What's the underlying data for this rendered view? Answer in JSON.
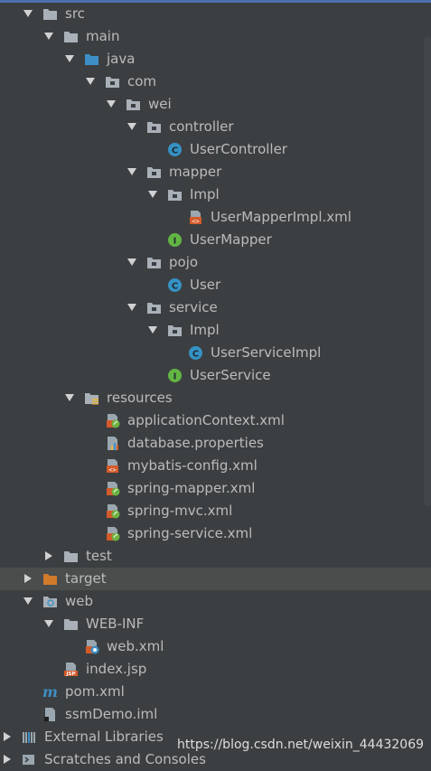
{
  "tree": [
    {
      "label": "src",
      "level": 0,
      "expanded": true,
      "icon": "folder-icon"
    },
    {
      "label": "main",
      "level": 1,
      "expanded": true,
      "icon": "folder-icon"
    },
    {
      "label": "java",
      "level": 2,
      "expanded": true,
      "icon": "source-folder-icon"
    },
    {
      "label": "com",
      "level": 3,
      "expanded": true,
      "icon": "package-icon"
    },
    {
      "label": "wei",
      "level": 4,
      "expanded": true,
      "icon": "package-icon"
    },
    {
      "label": "controller",
      "level": 5,
      "expanded": true,
      "icon": "package-icon"
    },
    {
      "label": "UserController",
      "level": 6,
      "icon": "class-icon"
    },
    {
      "label": "mapper",
      "level": 5,
      "expanded": true,
      "icon": "package-icon"
    },
    {
      "label": "Impl",
      "level": 6,
      "expanded": true,
      "icon": "package-icon"
    },
    {
      "label": "UserMapperImpl.xml",
      "level": 7,
      "icon": "xml-file-icon"
    },
    {
      "label": "UserMapper",
      "level": 6,
      "icon": "interface-icon"
    },
    {
      "label": "pojo",
      "level": 5,
      "expanded": true,
      "icon": "package-icon"
    },
    {
      "label": "User",
      "level": 6,
      "icon": "class-icon"
    },
    {
      "label": "service",
      "level": 5,
      "expanded": true,
      "icon": "package-icon"
    },
    {
      "label": "Impl",
      "level": 6,
      "expanded": true,
      "icon": "package-icon"
    },
    {
      "label": "UserServiceImpl",
      "level": 7,
      "icon": "class-icon"
    },
    {
      "label": "UserService",
      "level": 6,
      "icon": "interface-icon"
    },
    {
      "label": "resources",
      "level": 2,
      "expanded": true,
      "icon": "resources-folder-icon"
    },
    {
      "label": "applicationContext.xml",
      "level": 3,
      "icon": "spring-xml-icon"
    },
    {
      "label": "database.properties",
      "level": 3,
      "icon": "properties-file-icon"
    },
    {
      "label": "mybatis-config.xml",
      "level": 3,
      "icon": "xml-file-icon"
    },
    {
      "label": "spring-mapper.xml",
      "level": 3,
      "icon": "spring-xml-icon"
    },
    {
      "label": "spring-mvc.xml",
      "level": 3,
      "icon": "spring-xml-icon"
    },
    {
      "label": "spring-service.xml",
      "level": 3,
      "icon": "spring-xml-icon"
    },
    {
      "label": "test",
      "level": 1,
      "expanded": false,
      "icon": "folder-icon"
    },
    {
      "label": "target",
      "level": 0,
      "expanded": false,
      "icon": "excluded-folder-icon",
      "selected": true
    },
    {
      "label": "web",
      "level": 0,
      "expanded": true,
      "icon": "web-folder-icon"
    },
    {
      "label": "WEB-INF",
      "level": 1,
      "expanded": true,
      "icon": "folder-icon"
    },
    {
      "label": "web.xml",
      "level": 2,
      "icon": "web-xml-icon"
    },
    {
      "label": "index.jsp",
      "level": 1,
      "icon": "jsp-file-icon"
    },
    {
      "label": "pom.xml",
      "level": 0,
      "icon": "maven-icon"
    },
    {
      "label": "ssmDemo.iml",
      "level": 0,
      "icon": "iml-file-icon"
    },
    {
      "label": "External Libraries",
      "level": -1,
      "expanded": false,
      "icon": "libraries-icon"
    },
    {
      "label": "Scratches and Consoles",
      "level": -1,
      "expanded": false,
      "icon": "scratches-icon"
    }
  ],
  "watermark": "https://blog.csdn.net/weixin_44432069",
  "colors": {
    "background": "#3c3f41",
    "text": "#bbbbbb",
    "folder": "#a9b0b8",
    "source_folder": "#3d8fc6",
    "excluded": "#d07a2a",
    "class": "#3592c4",
    "interface": "#62b543",
    "selection": "#4b4d4d"
  }
}
